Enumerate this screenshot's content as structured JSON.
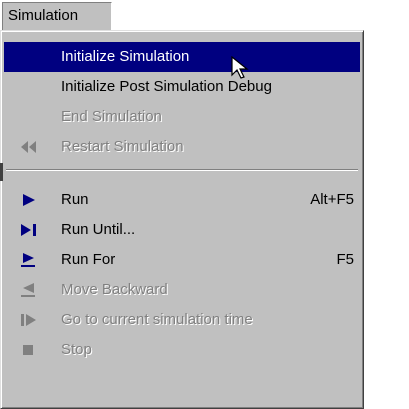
{
  "menubar": {
    "title": "Simulation"
  },
  "menu": {
    "items": [
      {
        "label": "Initialize Simulation",
        "shortcut": "",
        "state": "highlighted",
        "icon": ""
      },
      {
        "label": "Initialize Post Simulation Debug",
        "shortcut": "",
        "state": "enabled",
        "icon": ""
      },
      {
        "label": "End Simulation",
        "shortcut": "",
        "state": "disabled",
        "icon": ""
      },
      {
        "label": "Restart Simulation",
        "shortcut": "",
        "state": "disabled",
        "icon": "rewind-icon"
      },
      {
        "label": "Run",
        "shortcut": "Alt+F5",
        "state": "enabled",
        "icon": "play-icon"
      },
      {
        "label": "Run Until...",
        "shortcut": "",
        "state": "enabled",
        "icon": "play-to-bar-icon"
      },
      {
        "label": "Run For",
        "shortcut": "F5",
        "state": "enabled",
        "icon": "play-underline-icon"
      },
      {
        "label": "Move Backward",
        "shortcut": "",
        "state": "disabled",
        "icon": "step-back-icon"
      },
      {
        "label": "Go to current simulation time",
        "shortcut": "",
        "state": "disabled",
        "icon": "go-to-current-icon"
      },
      {
        "label": "Stop",
        "shortcut": "",
        "state": "disabled",
        "icon": "stop-icon"
      }
    ]
  },
  "colors": {
    "menu_background": "#c0c0c0",
    "highlight": "#000080",
    "enabled_icon": "#000080",
    "disabled_text": "#808080"
  }
}
